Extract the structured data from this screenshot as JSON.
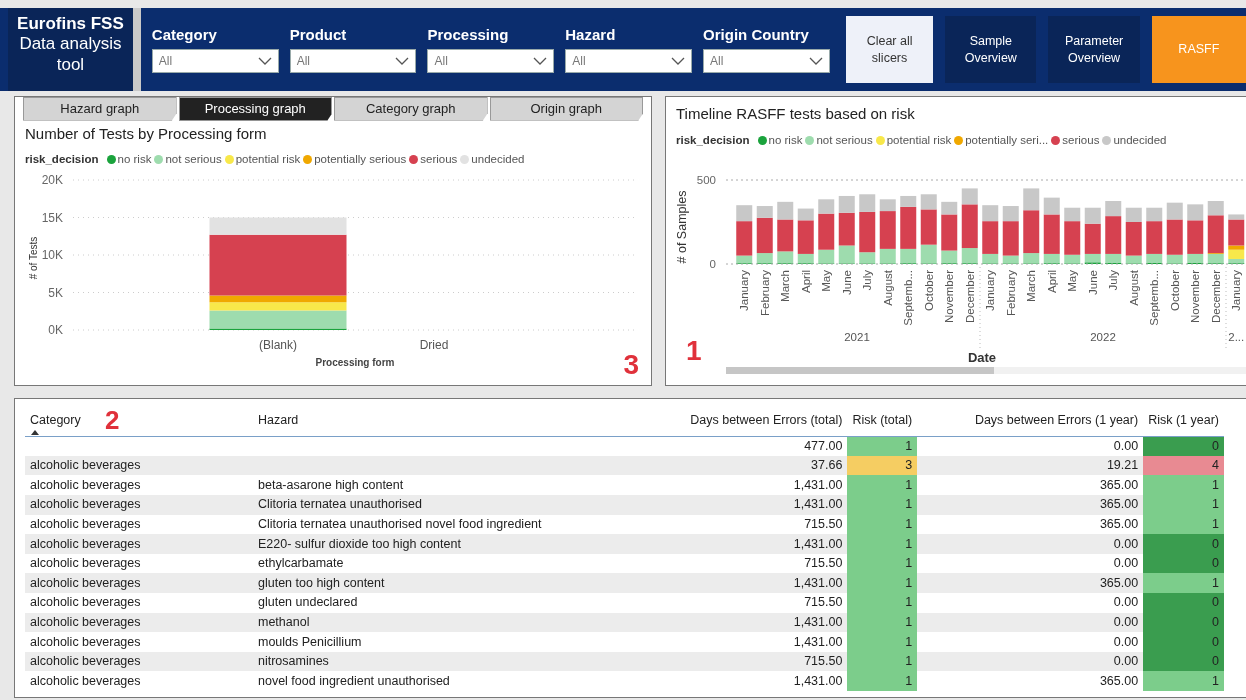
{
  "header": {
    "title_bold": "Eurofins FSS",
    "title": "Data analysis tool",
    "slicers": [
      {
        "label": "Category",
        "value": "All"
      },
      {
        "label": "Product",
        "value": "All"
      },
      {
        "label": "Processing",
        "value": "All"
      },
      {
        "label": "Hazard",
        "value": "All"
      },
      {
        "label": "Origin Country",
        "value": "All"
      }
    ],
    "buttons": [
      {
        "label": "Clear all slicers",
        "kind": "light"
      },
      {
        "label": "Sample Overview",
        "kind": "dark"
      },
      {
        "label": "Parameter Overview",
        "kind": "dark"
      },
      {
        "label": "RASFF",
        "kind": "accent"
      }
    ]
  },
  "processing_panel": {
    "tabs": [
      {
        "label": "Hazard graph",
        "selected": false
      },
      {
        "label": "Processing graph",
        "selected": true
      },
      {
        "label": "Category graph",
        "selected": false
      },
      {
        "label": "Origin graph",
        "selected": false
      }
    ],
    "title": "Number of Tests by Processing form",
    "legend_title": "risk_decision",
    "marker": "3",
    "chart_data": {
      "type": "bar",
      "grid": true,
      "xlabel": "Processing form",
      "ylabel": "# of Tests",
      "categories": [
        "(Blank)",
        "Dried"
      ],
      "stacked": true,
      "ylim": [
        0,
        20000
      ],
      "yticks": [
        {
          "value": 0,
          "label": "0K"
        },
        {
          "value": 5000,
          "label": "5K"
        },
        {
          "value": 10000,
          "label": "10K"
        },
        {
          "value": 15000,
          "label": "15K"
        },
        {
          "value": 20000,
          "label": "20K"
        }
      ],
      "series": [
        {
          "name": "no risk",
          "color": "#1aa33c",
          "values": [
            200,
            0
          ]
        },
        {
          "name": "not serious",
          "color": "#9edcae",
          "values": [
            2400,
            0
          ]
        },
        {
          "name": "potential risk",
          "color": "#f8e84a",
          "values": [
            1100,
            0
          ]
        },
        {
          "name": "potentially serious",
          "color": "#f0a800",
          "values": [
            900,
            0
          ]
        },
        {
          "name": "serious",
          "color": "#d64150",
          "values": [
            8100,
            0
          ]
        },
        {
          "name": "undecided",
          "color": "#e2e2e2",
          "values": [
            2300,
            0
          ]
        }
      ]
    }
  },
  "timeline_panel": {
    "title": "Timeline RASFF tests based on risk",
    "legend_title": "risk_decision",
    "marker": "1",
    "year_labels": [
      "2021",
      "2022",
      "2..."
    ],
    "chart_data": {
      "type": "bar",
      "xlabel": "Date",
      "ylabel": "# of Samples",
      "stacked": true,
      "ylim": [
        0,
        500
      ],
      "yticks": [
        0,
        500
      ],
      "categories": [
        "January",
        "February",
        "March",
        "April",
        "May",
        "June",
        "July",
        "August",
        "Septemb...",
        "October",
        "November",
        "December",
        "January",
        "February",
        "March",
        "April",
        "May",
        "June",
        "July",
        "August",
        "Septemb...",
        "October",
        "November",
        "December",
        "January"
      ],
      "series": [
        {
          "name": "no risk",
          "color": "#1aa33c",
          "values": [
            5,
            5,
            5,
            5,
            4,
            4,
            4,
            4,
            5,
            4,
            5,
            5,
            4,
            4,
            4,
            5,
            4,
            10,
            6,
            4,
            6,
            4,
            6,
            5,
            5
          ]
        },
        {
          "name": "not serious",
          "color": "#9edcae",
          "values": [
            45,
            60,
            70,
            55,
            81,
            106,
            66,
            86,
            85,
            111,
            75,
            90,
            56,
            46,
            61,
            55,
            51,
            50,
            54,
            46,
            54,
            51,
            54,
            55,
            25
          ]
        },
        {
          "name": "potential risk",
          "color": "#f8e84a",
          "values": [
            0,
            0,
            0,
            0,
            0,
            0,
            0,
            0,
            0,
            0,
            0,
            0,
            0,
            0,
            0,
            0,
            0,
            0,
            0,
            0,
            0,
            0,
            0,
            0,
            55
          ]
        },
        {
          "name": "potentially seri...",
          "color": "#f0a800",
          "values": [
            0,
            0,
            0,
            0,
            0,
            0,
            0,
            0,
            0,
            0,
            0,
            0,
            0,
            0,
            0,
            0,
            0,
            0,
            0,
            0,
            0,
            0,
            0,
            5,
            25
          ]
        },
        {
          "name": "serious",
          "color": "#d64150",
          "values": [
            205,
            210,
            190,
            200,
            215,
            195,
            240,
            225,
            250,
            210,
            215,
            260,
            195,
            205,
            255,
            235,
            200,
            180,
            225,
            200,
            195,
            210,
            200,
            225,
            155
          ]
        },
        {
          "name": "undecided",
          "color": "#c8c8c8",
          "values": [
            95,
            70,
            105,
            70,
            85,
            100,
            105,
            70,
            65,
            90,
            75,
            95,
            95,
            90,
            130,
            100,
            80,
            95,
            90,
            85,
            80,
            100,
            95,
            85,
            30
          ]
        }
      ]
    }
  },
  "table": {
    "marker": "2",
    "columns": [
      {
        "label": "Category",
        "sorted": true
      },
      {
        "label": "Hazard",
        "sorted": false
      },
      {
        "label": "Days between Errors (total)",
        "sorted": false
      },
      {
        "label": "Risk (total)",
        "sorted": false
      },
      {
        "label": "Days between Errors (1 year)",
        "sorted": false
      },
      {
        "label": "Risk (1 year)",
        "sorted": false
      }
    ],
    "rows": [
      {
        "category": "",
        "hazard": "",
        "days_total": "477.00",
        "risk_total": "1",
        "days_1y": "0.00",
        "risk_1y": "0"
      },
      {
        "category": "alcoholic beverages",
        "hazard": "",
        "days_total": "37.66",
        "risk_total": "3",
        "days_1y": "19.21",
        "risk_1y": "4"
      },
      {
        "category": "alcoholic beverages",
        "hazard": "beta-asarone high content",
        "days_total": "1,431.00",
        "risk_total": "1",
        "days_1y": "365.00",
        "risk_1y": "1"
      },
      {
        "category": "alcoholic beverages",
        "hazard": "Clitoria ternatea unauthorised",
        "days_total": "1,431.00",
        "risk_total": "1",
        "days_1y": "365.00",
        "risk_1y": "1"
      },
      {
        "category": "alcoholic beverages",
        "hazard": "Clitoria ternatea unauthorised novel food ingredient",
        "days_total": "715.50",
        "risk_total": "1",
        "days_1y": "365.00",
        "risk_1y": "1"
      },
      {
        "category": "alcoholic beverages",
        "hazard": "E220- sulfur dioxide too high content",
        "days_total": "1,431.00",
        "risk_total": "1",
        "days_1y": "0.00",
        "risk_1y": "0"
      },
      {
        "category": "alcoholic beverages",
        "hazard": "ethylcarbamate",
        "days_total": "715.50",
        "risk_total": "1",
        "days_1y": "0.00",
        "risk_1y": "0"
      },
      {
        "category": "alcoholic beverages",
        "hazard": "gluten too high content",
        "days_total": "1,431.00",
        "risk_total": "1",
        "days_1y": "365.00",
        "risk_1y": "1"
      },
      {
        "category": "alcoholic beverages",
        "hazard": "gluten undeclared",
        "days_total": "715.50",
        "risk_total": "1",
        "days_1y": "0.00",
        "risk_1y": "0"
      },
      {
        "category": "alcoholic beverages",
        "hazard": "methanol",
        "days_total": "1,431.00",
        "risk_total": "1",
        "days_1y": "0.00",
        "risk_1y": "0"
      },
      {
        "category": "alcoholic beverages",
        "hazard": "moulds Penicillium",
        "days_total": "1,431.00",
        "risk_total": "1",
        "days_1y": "0.00",
        "risk_1y": "0"
      },
      {
        "category": "alcoholic beverages",
        "hazard": "nitrosamines",
        "days_total": "715.50",
        "risk_total": "1",
        "days_1y": "0.00",
        "risk_1y": "0"
      },
      {
        "category": "alcoholic beverages",
        "hazard": "novel food ingredient unauthorised",
        "days_total": "1,431.00",
        "risk_total": "1",
        "days_1y": "365.00",
        "risk_1y": "1"
      }
    ]
  }
}
